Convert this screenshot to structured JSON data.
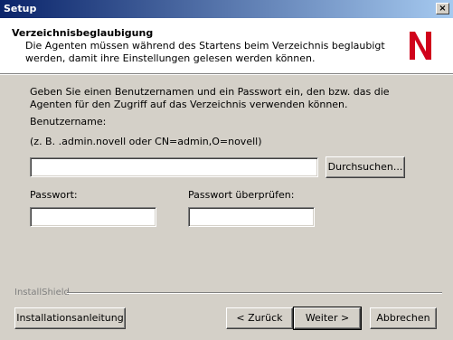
{
  "window": {
    "title": "Setup",
    "close_glyph": "×"
  },
  "header": {
    "title": "Verzeichnisbeglaubigung",
    "subtitle": "Die Agenten müssen während des Startens beim Verzeichnis beglaubigt werden, damit ihre Einstellungen gelesen werden können.",
    "logo_letter": "N",
    "logo_color": "#d0021b"
  },
  "body": {
    "instructions": "Geben Sie einen Benutzernamen und ein Passwort ein, den bzw. das die Agenten für den Zugriff auf das Verzeichnis verwenden können.",
    "username_label": "Benutzername:",
    "username_hint": "(z. B. .admin.novell oder CN=admin,O=novell)",
    "username_value": "",
    "browse_button": "Durchsuchen...",
    "password_label": "Passwort:",
    "password_value": "",
    "confirm_label": "Passwort überprüfen:",
    "confirm_value": ""
  },
  "footer": {
    "brand": "InstallShield",
    "guide_button": "Installationsanleitung",
    "back_button": "< Zurück",
    "next_button": "Weiter >",
    "cancel_button": "Abbrechen"
  }
}
